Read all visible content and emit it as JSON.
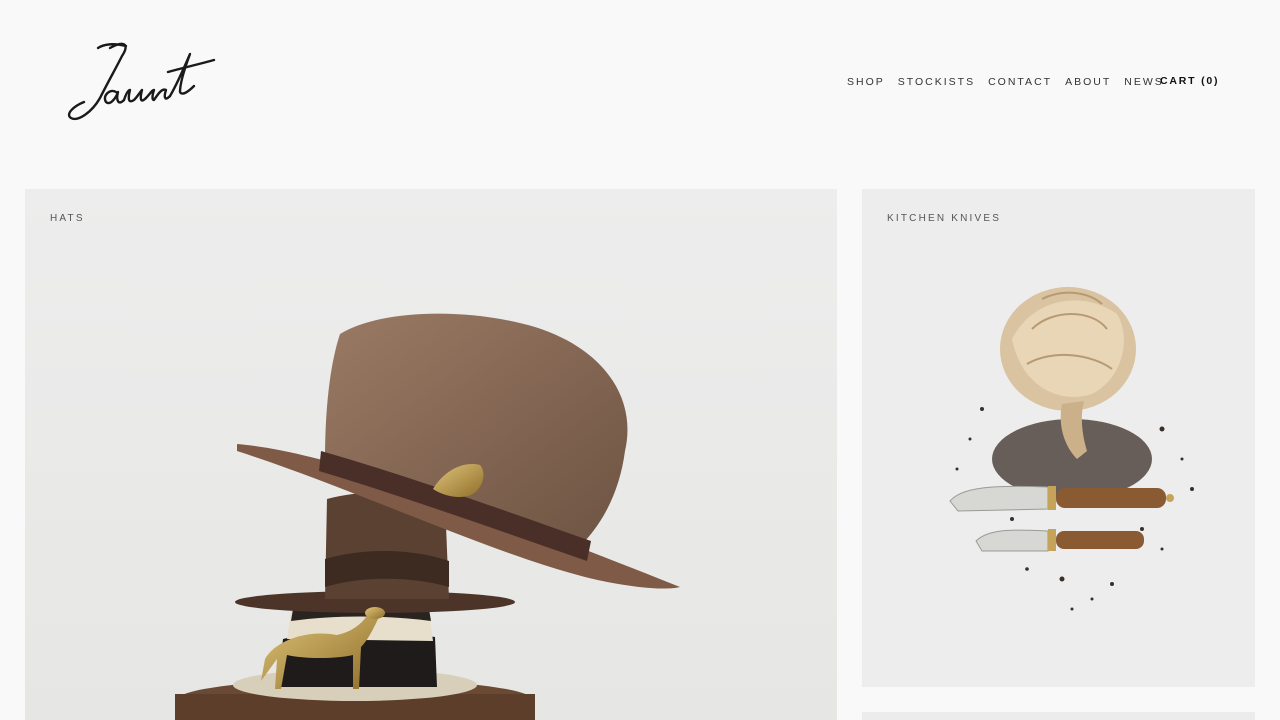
{
  "brand": {
    "logo_text": "Jaunt"
  },
  "nav": {
    "items": [
      {
        "label": "SHOP"
      },
      {
        "label": "STOCKISTS"
      },
      {
        "label": "CONTACT"
      },
      {
        "label": "ABOUT"
      },
      {
        "label": "NEWS"
      }
    ],
    "cart_label": "CART (0)"
  },
  "tiles": [
    {
      "label": "HATS"
    },
    {
      "label": "KITCHEN KNIVES"
    }
  ],
  "colors": {
    "background": "#f9f9f9",
    "tile": "#ececec",
    "hat_felt": "#8a6b57",
    "brass": "#b8953f",
    "knife_handle": "#8a5a33"
  }
}
